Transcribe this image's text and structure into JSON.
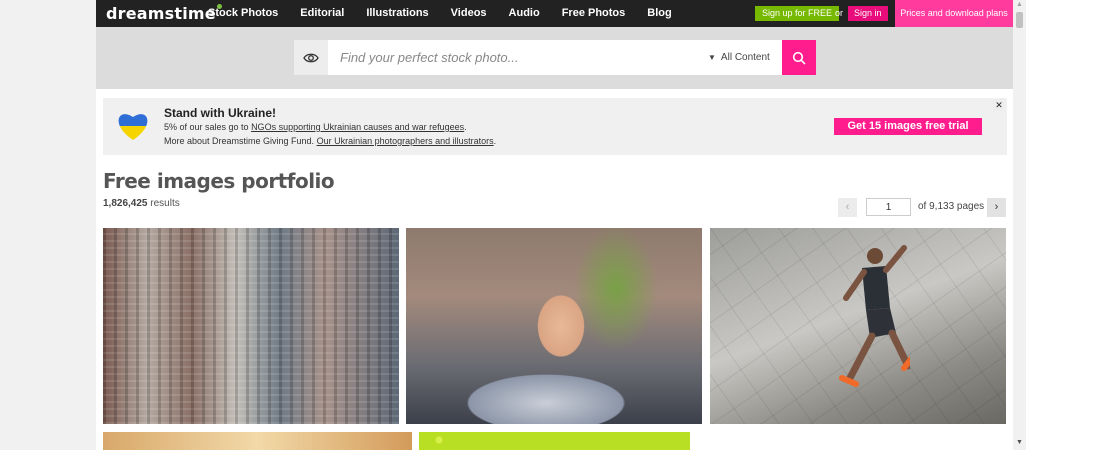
{
  "nav": {
    "logo": "dreamstime",
    "links": [
      "Stock Photos",
      "Editorial",
      "Illustrations",
      "Videos",
      "Audio",
      "Free Photos",
      "Blog"
    ],
    "signup": "Sign up for FREE",
    "or": "or",
    "signin": "Sign in",
    "plans": "Prices and download plans"
  },
  "search": {
    "placeholder": "Find your perfect stock photo...",
    "filter": "All Content"
  },
  "banner": {
    "title": "Stand with Ukraine!",
    "line1_prefix": "5% of our sales go to ",
    "line1_link": "NGOs supporting Ukrainian causes and war refugees",
    "line1_suffix": ".",
    "line2_prefix": "More about Dreamstime Giving Fund. ",
    "line2_link": "Our Ukrainian photographers and illustrators",
    "line2_suffix": ".",
    "cta": "Get 15 images free trial",
    "close": "✕"
  },
  "portfolio": {
    "title": "Free images portfolio",
    "results_count": "1,826,425",
    "results_label": " results"
  },
  "pager": {
    "current": "1",
    "of_label": "of 9,133 pages",
    "prev": "‹",
    "next": "›"
  },
  "colors": {
    "brand_pink": "#ff1d8e",
    "signup_green": "#77b900",
    "nav_dark": "#222222"
  }
}
